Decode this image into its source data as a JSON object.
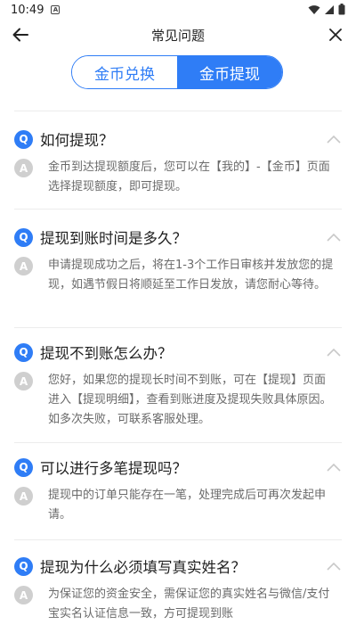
{
  "status_bar": {
    "time": "10:49",
    "notif_letter": "A"
  },
  "header": {
    "title": "常见问题"
  },
  "tabs": [
    {
      "label": "金币兑换",
      "active": false
    },
    {
      "label": "金币提现",
      "active": true
    }
  ],
  "colors": {
    "accent": "#2f7df6",
    "answer_badge": "#cfcfcf"
  },
  "icons": {
    "back": "arrow-left-icon",
    "close": "close-icon",
    "collapse": "chevron-up-icon"
  },
  "faq": [
    {
      "q_badge": "Q",
      "question": "如何提现？",
      "a_badge": "A",
      "answer": "金币到达提现额度后，您可以在【我的】-【金币】页面选择提现额度，即可提现。"
    },
    {
      "q_badge": "Q",
      "question": "提现到账时间是多久？",
      "a_badge": "A",
      "answer": "申请提现成功之后，将在1-3个工作日审核并发放您的提现，如遇节假日将顺延至工作日发放，请您耐心等待。"
    },
    {
      "q_badge": "Q",
      "question": "提现不到账怎么办？",
      "a_badge": "A",
      "answer": "您好，如果您的提现长时间不到账，可在【提现】页面进入【提现明细】，查看到账进度及提现失败具体原因。如多次失败，可联系客服处理。"
    },
    {
      "q_badge": "Q",
      "question": "可以进行多笔提现吗？",
      "a_badge": "A",
      "answer": "提现中的订单只能存在一笔，处理完成后可再次发起申请。"
    },
    {
      "q_badge": "Q",
      "question": "提现为什么必须填写真实姓名？",
      "a_badge": "A",
      "answer": "为保证您的资金安全，需保证您的真实姓名与微信/支付宝实名认证信息一致，方可提现到账"
    }
  ]
}
